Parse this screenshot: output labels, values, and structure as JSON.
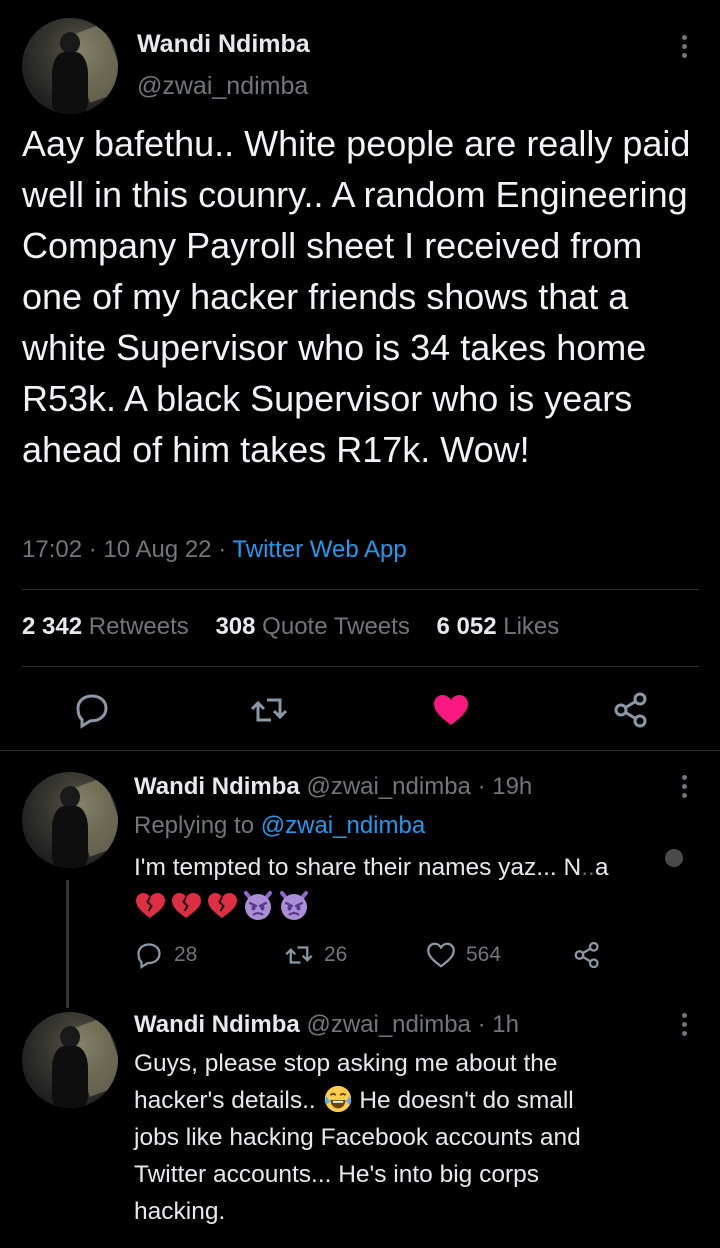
{
  "main_tweet": {
    "author_name": "Wandi Ndimba",
    "handle": "@zwai_ndimba",
    "text": "Aay bafethu.. White people are really paid well in this counry.. A random Engineering Company Payroll sheet I received from one of my hacker friends shows that a white Supervisor who is 34 takes home R53k. A black Supervisor who is years ahead of him takes R17k. Wow!",
    "time": "17:02",
    "date": "10 Aug 22",
    "source": "Twitter Web App",
    "separator": "·",
    "stats": {
      "retweets_count": "2 342",
      "retweets_label": "Retweets",
      "quotes_count": "308",
      "quotes_label": "Quote Tweets",
      "likes_count": "6 052",
      "likes_label": "Likes"
    },
    "actions": [
      "reply-icon",
      "retweet-icon",
      "heart-icon",
      "share-icon"
    ],
    "liked_color": "#f91880"
  },
  "replies": [
    {
      "author_name": "Wandi Ndimba",
      "handle": "@zwai_ndimba",
      "age": "· 19h",
      "replying_prefix": "Replying to",
      "replying_to": "@zwai_ndimba",
      "text": "I'm tempted to share their names yaz... N",
      "text_tail": "a",
      "emoji": [
        "broken-heart",
        "broken-heart",
        "broken-heart",
        "angry-devil",
        "angry-devil"
      ],
      "reply_count": "28",
      "retweet_count": "26",
      "like_count": "564"
    },
    {
      "author_name": "Wandi Ndimba",
      "handle": "@zwai_ndimba",
      "age": "· 1h",
      "lines": [
        "Guys, please stop asking me about the",
        "hacker's details..",
        "He doesn't do small",
        "jobs like hacking Facebook accounts and",
        "Twitter accounts... He's into big corps",
        "hacking."
      ],
      "emoji": [
        "tears-of-joy"
      ]
    }
  ],
  "colors": {
    "background": "#000000",
    "text": "#e7e9ea",
    "muted": "#71767b",
    "link": "#1d9bf0",
    "like": "#f91880"
  }
}
